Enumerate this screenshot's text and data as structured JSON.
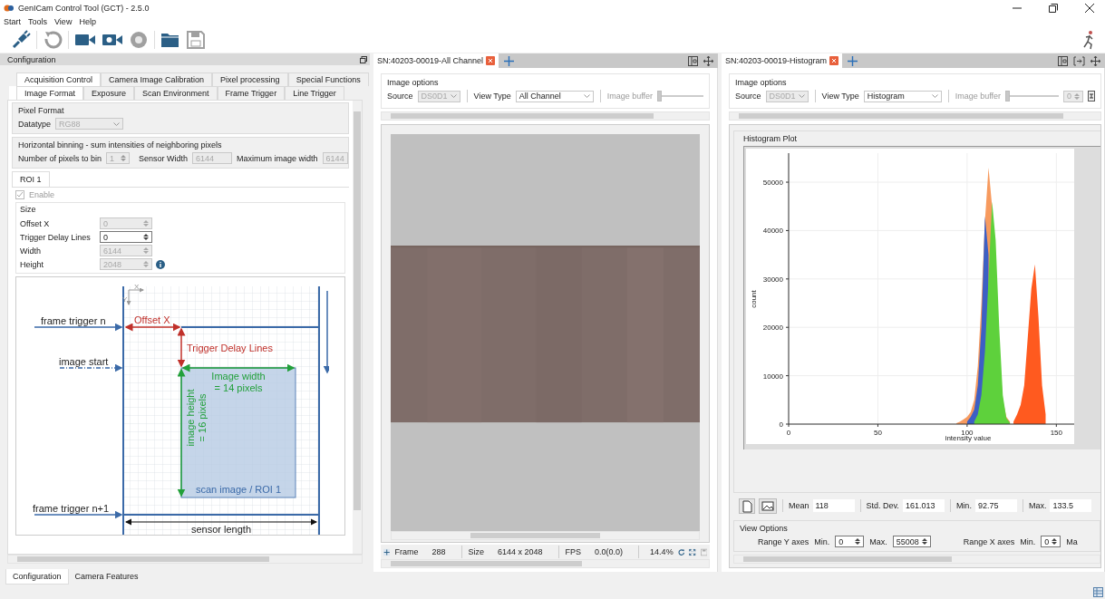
{
  "window": {
    "title": "GenICam Control Tool (GCT) - 2.5.0"
  },
  "menu": [
    "Start",
    "Tools",
    "View",
    "Help"
  ],
  "config": {
    "title": "Configuration",
    "tabs": [
      {
        "label": "Acquisition Control",
        "selected": true
      },
      {
        "label": "Camera Image Calibration",
        "selected": false
      },
      {
        "label": "Pixel processing",
        "selected": false
      },
      {
        "label": "Special Functions",
        "selected": false
      }
    ],
    "subtabs": [
      {
        "label": "Image Format",
        "selected": true
      },
      {
        "label": "Exposure",
        "selected": false
      },
      {
        "label": "Scan Environment",
        "selected": false
      },
      {
        "label": "Frame Trigger",
        "selected": false
      },
      {
        "label": "Line Trigger",
        "selected": false
      }
    ],
    "pixel_format": {
      "legend": "Pixel Format",
      "datatype_label": "Datatype",
      "datatype_value": "RG88",
      "disabled": true
    },
    "binning": {
      "legend": "Horizontal binning - sum intensities of neighboring pixels",
      "bin_label": "Number of pixels to bin",
      "bin_value": "1",
      "sensor_width_label": "Sensor Width",
      "sensor_width_value": "6144",
      "max_width_label": "Maximum image width",
      "max_width_value": "6144"
    },
    "roi_tab": {
      "label": "ROI 1",
      "selected": true
    },
    "enable": {
      "label": "Enable",
      "checked": true,
      "disabled": true
    },
    "size_legend": "Size",
    "size_fields": [
      {
        "label": "Offset X",
        "value": "0",
        "disabled": true,
        "info": false
      },
      {
        "label": "Trigger Delay Lines",
        "value": "0",
        "disabled": false,
        "info": false
      },
      {
        "label": "Width",
        "value": "6144",
        "disabled": true,
        "info": false
      },
      {
        "label": "Height",
        "value": "2048",
        "disabled": true,
        "info": true
      }
    ],
    "diagram": {
      "axis_x": "X",
      "axis_y": "Y",
      "frame_trigger_n": "frame trigger n",
      "image_start": "image start",
      "frame_trigger_n1": "frame trigger n+1",
      "offset_x": "Offset X",
      "trigger_delay": "Trigger Delay Lines",
      "image_width": [
        "Image width",
        "= 14 pixels"
      ],
      "image_height": [
        "image height",
        "= 16 pixels"
      ],
      "roi": "scan image / ROI 1",
      "sensor_length": "sensor length"
    }
  },
  "bottom_tabs": [
    {
      "label": "Configuration",
      "selected": true
    },
    {
      "label": "Camera Features",
      "selected": false
    }
  ],
  "image_view": {
    "tab": "SN:40203-00019-All Channel",
    "options_legend": "Image options",
    "source_label": "Source",
    "source_value": "DS0D1",
    "view_type_label": "View Type",
    "view_type_value": "All Channel",
    "buffer_label": "Image buffer",
    "buffer": {
      "level": 0
    },
    "status": {
      "frame_label": "Frame",
      "frame": "288",
      "size_label": "Size",
      "size": "6144 x 2048",
      "fps_label": "FPS",
      "fps": "0.0(0.0)",
      "zoom": "14.4%"
    }
  },
  "histogram_view": {
    "tab": "SN:40203-00019-Histogram",
    "options_legend": "Image options",
    "source_label": "Source",
    "source_value": "DS0D1",
    "view_type_label": "View Type",
    "view_type_value": "Histogram",
    "buffer_label": "Image buffer",
    "buffer": {
      "level": 0
    },
    "buffer_value": "0",
    "group": "Histogram Plot",
    "chart_data": {
      "type": "area",
      "xlabel": "intensity value",
      "ylabel": "count",
      "x": [
        94,
        96,
        98,
        100,
        102,
        104,
        106,
        108,
        110,
        112,
        114,
        116,
        118,
        120,
        122,
        124,
        126,
        128,
        130,
        132,
        134,
        136,
        138,
        140,
        142,
        144
      ],
      "series": [
        {
          "color": "#f79a5e",
          "values": [
            200,
            500,
            1000,
            1500,
            2500,
            5000,
            12000,
            25000,
            42000,
            53000,
            45000,
            30000,
            15000,
            5000,
            1500,
            500,
            null,
            null,
            null,
            null,
            null,
            null,
            null,
            null,
            null,
            null
          ]
        },
        {
          "color": "#3d5fc4",
          "values": [
            null,
            null,
            null,
            500,
            1500,
            3000,
            8000,
            20000,
            43000,
            35000,
            null,
            null,
            null,
            null,
            null,
            null,
            null,
            null,
            null,
            null,
            null,
            null,
            null,
            null,
            null,
            null
          ]
        },
        {
          "color": "#5ed13c",
          "values": [
            null,
            null,
            null,
            null,
            null,
            500,
            2000,
            6000,
            15000,
            30000,
            46000,
            38000,
            20000,
            6000,
            1200,
            300,
            null,
            null,
            null,
            null,
            null,
            null,
            null,
            null,
            null,
            null
          ]
        },
        {
          "color": "#ff5a1f",
          "values": [
            null,
            null,
            null,
            null,
            null,
            null,
            null,
            null,
            null,
            null,
            null,
            null,
            null,
            null,
            null,
            null,
            500,
            2000,
            4000,
            8000,
            18000,
            28000,
            33000,
            22000,
            8000,
            2000
          ]
        }
      ],
      "xlim": [
        0,
        160
      ],
      "ylim": [
        0,
        56000
      ],
      "grid": true,
      "xticks": [
        0,
        50,
        100,
        150
      ],
      "yticks": [
        0,
        10000,
        20000,
        30000,
        40000,
        50000
      ]
    },
    "stats": [
      {
        "label": "Mean",
        "value": "118"
      },
      {
        "label": "Std. Dev.",
        "value": "161.013"
      },
      {
        "label": "Min.",
        "value": "92.75"
      },
      {
        "label": "Max.",
        "value": "133.5"
      }
    ],
    "view_options": {
      "legend": "View Options",
      "range_y": {
        "label": "Range Y axes",
        "min_label": "Min.",
        "min": "0",
        "max_label": "Max.",
        "max": "55008"
      },
      "range_x": {
        "label": "Range X axes",
        "min_label": "Min.",
        "min": "0",
        "max_label": "Ma"
      }
    }
  }
}
